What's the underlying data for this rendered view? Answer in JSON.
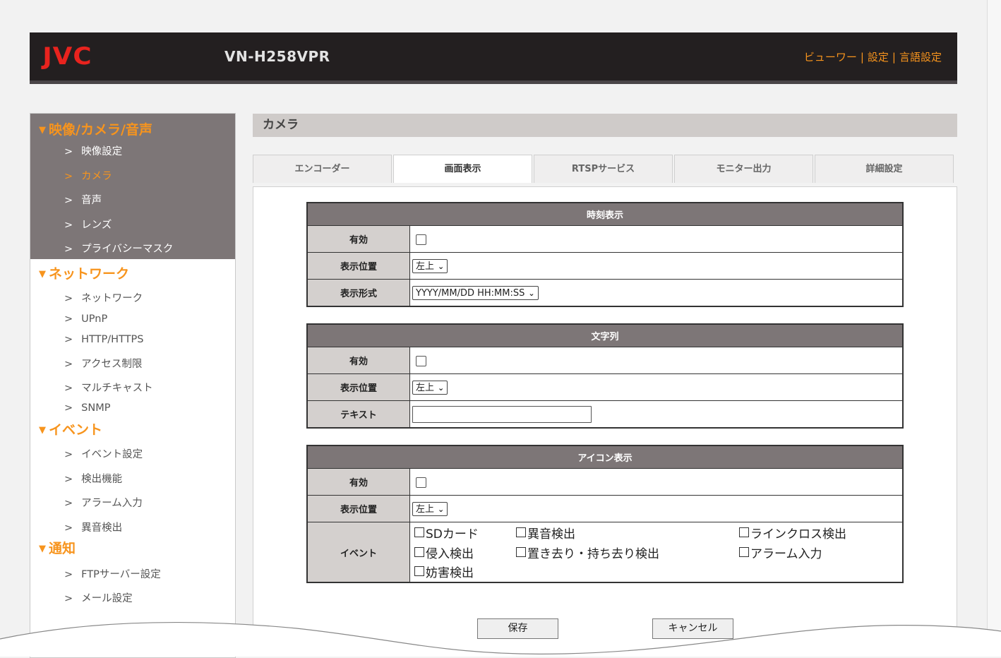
{
  "header": {
    "logo": "JVC",
    "model": "VN-H258VPR",
    "nav": [
      "ビューワー",
      "設定",
      "言語設定"
    ],
    "separator": "|"
  },
  "sidebar": {
    "sections": [
      {
        "title": "映像/カメラ/音声",
        "items": [
          "映像設定",
          "カメラ",
          "音声",
          "レンズ",
          "プライバシーマスク"
        ]
      },
      {
        "title": "ネットワーク",
        "items": [
          "ネットワーク",
          "UPnP",
          "HTTP/HTTPS",
          "アクセス制限",
          "マルチキャスト",
          "SNMP"
        ]
      },
      {
        "title": "イベント",
        "items": [
          "イベント設定",
          "検出機能",
          "アラーム入力",
          "異音検出"
        ]
      },
      {
        "title": "通知",
        "items": [
          "FTPサーバー設定",
          "メール設定"
        ]
      }
    ],
    "chevron": ">",
    "triangle": "▼",
    "current_item": "カメラ"
  },
  "main": {
    "title": "カメラ",
    "tabs": [
      "エンコーダー",
      "画面表示",
      "RTSPサービス",
      "モニター出力",
      "詳細設定"
    ],
    "active_tab": "画面表示"
  },
  "time_display": {
    "heading": "時刻表示",
    "enable_label": "有効",
    "position_label": "表示位置",
    "position_value": "左上",
    "format_label": "表示形式",
    "format_value": "YYYY/MM/DD HH:MM:SS"
  },
  "string_display": {
    "heading": "文字列",
    "enable_label": "有効",
    "position_label": "表示位置",
    "position_value": "左上",
    "text_label": "テキスト",
    "text_value": ""
  },
  "icon_display": {
    "heading": "アイコン表示",
    "enable_label": "有効",
    "position_label": "表示位置",
    "position_value": "左上",
    "event_label": "イベント",
    "events": [
      "SDカード",
      "異音検出",
      "ラインクロス検出",
      "侵入検出",
      "置き去り・持ち去り検出",
      "アラーム入力",
      "妨害検出"
    ]
  },
  "buttons": {
    "save": "保存",
    "cancel": "キャンセル"
  },
  "colors": {
    "accent": "#f7941d",
    "logo_red": "#e8231e",
    "header_bg": "#231f20",
    "section_header_bg": "#7d7677",
    "label_bg": "#d4d0ce"
  }
}
